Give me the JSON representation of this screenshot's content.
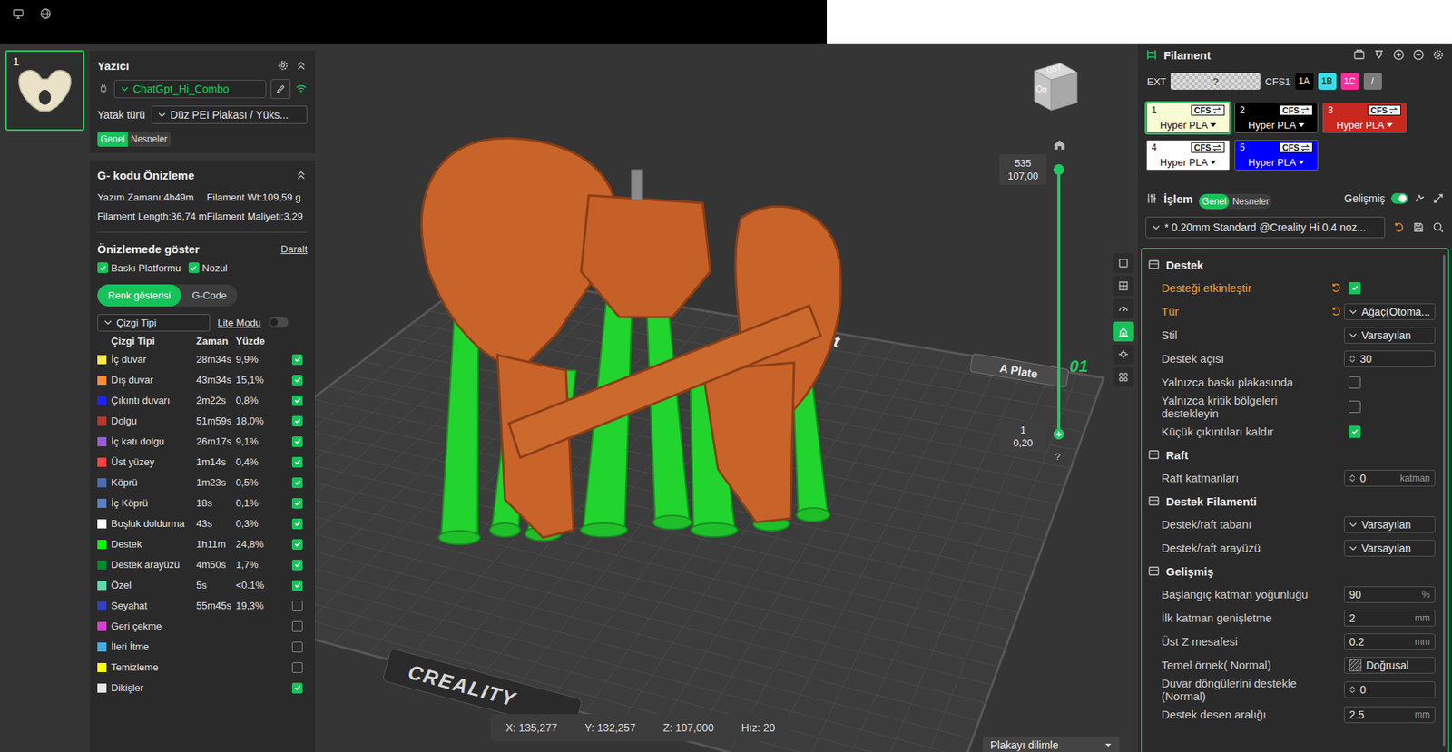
{
  "plates": [
    {
      "number": "1",
      "selected": true
    }
  ],
  "printer": {
    "title": "Yazıcı",
    "name": "ChatGpt_Hi_Combo",
    "connected": true,
    "bed_label": "Yatak türü",
    "bed_value": "Düz PEI Plakası / Yüks...",
    "tabs": [
      {
        "label": "Genel",
        "selected": true
      },
      {
        "label": "Nesneler",
        "selected": false
      }
    ]
  },
  "gcode": {
    "title": "G- kodu Önizleme",
    "stats": [
      "Yazım Zamanı:4h49m",
      "Filament Wt:109,59 g",
      "Filament Length:36,74 m",
      "Filament Maliyeti:3,29"
    ]
  },
  "preview": {
    "title": "Önizlemede göster",
    "collapse": "Daralt",
    "checks": [
      {
        "label": "Baskı Platformu",
        "checked": true
      },
      {
        "label": "Nozul",
        "checked": true
      }
    ],
    "modes": [
      {
        "label": "Renk gösterisi",
        "selected": true
      },
      {
        "label": "G-Code",
        "selected": false
      }
    ],
    "view_select": "Çizgi Tipi",
    "lite": {
      "label": "Lite Modu",
      "on": false
    },
    "columns": [
      "Çizgi Tipi",
      "Zaman",
      "Yüzde"
    ],
    "rows": [
      {
        "name": "İç duvar",
        "time": "28m34s",
        "percent": "9,9%",
        "color": "#ffe74b",
        "checked": true
      },
      {
        "name": "Dış duvar",
        "time": "43m34s",
        "percent": "15,1%",
        "color": "#ff8c38",
        "checked": true
      },
      {
        "name": "Çıkıntı duvarı",
        "time": "2m22s",
        "percent": "0,8%",
        "color": "#1f22ff",
        "checked": true
      },
      {
        "name": "Dolgu",
        "time": "51m59s",
        "percent": "18,0%",
        "color": "#b33a2e",
        "checked": true
      },
      {
        "name": "İç katı dolgu",
        "time": "26m17s",
        "percent": "9,1%",
        "color": "#9a5cd6",
        "checked": true
      },
      {
        "name": "Üst yüzey",
        "time": "1m14s",
        "percent": "0,4%",
        "color": "#ff4040",
        "checked": true
      },
      {
        "name": "Köprü",
        "time": "1m23s",
        "percent": "0,5%",
        "color": "#4d6bb0",
        "checked": true
      },
      {
        "name": "İç Köprü",
        "time": "18s",
        "percent": "0,1%",
        "color": "#5a80c8",
        "checked": true
      },
      {
        "name": "Boşluk doldurma",
        "time": "43s",
        "percent": "0,3%",
        "color": "#ffffff",
        "checked": true
      },
      {
        "name": "Destek",
        "time": "1h11m",
        "percent": "24,8%",
        "color": "#00ff00",
        "checked": true
      },
      {
        "name": "Destek arayüzü",
        "time": "4m50s",
        "percent": "1,7%",
        "color": "#008a2e",
        "checked": true
      },
      {
        "name": "Özel",
        "time": "5s",
        "percent": "<0.1%",
        "color": "#5ed8a8",
        "checked": true
      },
      {
        "name": "Seyahat",
        "time": "55m45s",
        "percent": "19,3%",
        "color": "#3040c0",
        "checked": false
      },
      {
        "name": "Geri çekme",
        "time": "",
        "percent": "",
        "color": "#d43fd4",
        "checked": false
      },
      {
        "name": "İleri İtme",
        "time": "",
        "percent": "",
        "color": "#45aee0",
        "checked": false
      },
      {
        "name": "Temizleme",
        "time": "",
        "percent": "",
        "color": "#ffff00",
        "checked": false
      },
      {
        "name": "Dikişler",
        "time": "",
        "percent": "",
        "color": "#e6e6e6",
        "checked": true
      }
    ]
  },
  "viewport": {
    "cube": {
      "top": "ÜST",
      "front": "Ön"
    },
    "plate_labels": {
      "print": "print",
      "name": "A Plate",
      "number": "01",
      "brand": "CREALITY"
    },
    "slider": {
      "top_layer": "535",
      "top_z": "107,00",
      "bottom_layer": "1",
      "bottom_z": "0,20",
      "level_low": 0,
      "level_high": 1
    },
    "help": "?",
    "toolbar": [
      {
        "selected": false
      },
      {
        "selected": false
      },
      {
        "selected": false
      },
      {
        "selected": true
      },
      {
        "selected": false
      },
      {
        "selected": false
      }
    ],
    "status": [
      "X: 135,277",
      "Y: 132,257",
      "Z: 107,000",
      "Hız: 20"
    ],
    "slice_button": "Plakayı dilimle"
  },
  "filament": {
    "title": "Filament",
    "ext_label": "EXT",
    "ext_value": "?",
    "cfs_label": "CFS1",
    "cfs_chips": [
      {
        "label": "1A",
        "color": "#000000"
      },
      {
        "label": "1B",
        "color": "#36e0e8"
      },
      {
        "label": "1C",
        "color": "#ff2d9a"
      },
      {
        "label": "/",
        "color": "#7a7a7a"
      }
    ],
    "slots": [
      {
        "number": "1",
        "badge": "CFS",
        "type": "Hyper PLA",
        "color": "#f8fcd2",
        "selected": true
      },
      {
        "number": "2",
        "badge": "CFS",
        "type": "Hyper PLA",
        "color": "#000000",
        "selected": false
      },
      {
        "number": "3",
        "badge": "CFS",
        "type": "Hyper PLA",
        "color": "#c8281e",
        "selected": false
      },
      {
        "number": "4",
        "badge": "CFS",
        "type": "Hyper PLA",
        "color": "#ffffff",
        "selected": false
      },
      {
        "number": "5",
        "badge": "CFS",
        "type": "Hyper PLA",
        "color": "#0000ff",
        "selected": false
      }
    ]
  },
  "process": {
    "title": "İşlem",
    "tabs": [
      {
        "label": "Genel",
        "selected": true
      },
      {
        "label": "Nesneler",
        "selected": false
      }
    ],
    "advanced": {
      "label": "Gelişmiş",
      "on": true
    },
    "preset": "* 0.20mm Standard @Creality Hi 0.4 noz...",
    "preset_modified": true,
    "sections": [
      {
        "title": "Destek",
        "rows": [
          {
            "kind": "check",
            "label": "Desteği etkinleştir",
            "checked": true,
            "modified": true
          },
          {
            "kind": "select",
            "label": "Tür",
            "value": "Ağaç(Otoma...",
            "modified": true
          },
          {
            "kind": "select",
            "label": "Stil",
            "value": "Varsayılan",
            "modified": false
          },
          {
            "kind": "spin",
            "label": "Destek açısı",
            "value": "30",
            "modified": false
          },
          {
            "kind": "check",
            "label": "Yalnızca baskı plakasında",
            "checked": false,
            "modified": false
          },
          {
            "kind": "check",
            "label": "Yalnızca kritik bölgeleri destekleyin",
            "checked": false,
            "modified": false
          },
          {
            "kind": "check",
            "label": "Küçük çıkıntıları kaldır",
            "checked": true,
            "modified": false
          }
        ]
      },
      {
        "title": "Raft",
        "rows": [
          {
            "kind": "spin",
            "label": "Raft katmanları",
            "value": "0",
            "unit": "katman",
            "modified": false
          }
        ]
      },
      {
        "title": "Destek Filamenti",
        "rows": [
          {
            "kind": "select",
            "label": "Destek/raft tabanı",
            "value": "Varsayılan",
            "modified": false
          },
          {
            "kind": "select",
            "label": "Destek/raft arayüzü",
            "value": "Varsayılan",
            "modified": false
          }
        ]
      },
      {
        "title": "Gelişmiş",
        "rows": [
          {
            "kind": "field",
            "label": "Başlangıç katman yoğunluğu",
            "value": "90",
            "unit": "%",
            "modified": false
          },
          {
            "kind": "field",
            "label": "İlk katman genişletme",
            "value": "2",
            "unit": "mm",
            "modified": false
          },
          {
            "kind": "field",
            "label": "Üst Z mesafesi",
            "value": "0.2",
            "unit": "mm",
            "modified": false
          },
          {
            "kind": "pattern",
            "label": "Temel örnek( Normal)",
            "value": "Doğrusal",
            "modified": false
          },
          {
            "kind": "spin",
            "label": "Duvar döngülerini destekle (Normal)",
            "value": "0",
            "modified": false
          },
          {
            "kind": "field",
            "label": "Destek desen aralığı",
            "value": "2.5",
            "unit": "mm",
            "modified": false
          }
        ]
      }
    ]
  }
}
